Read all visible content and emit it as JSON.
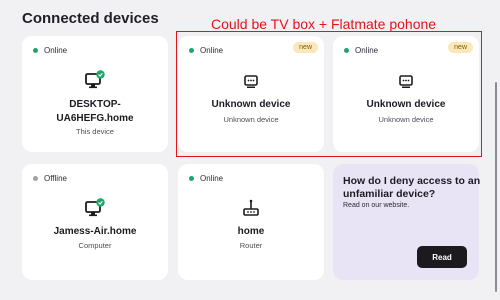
{
  "page": {
    "title": "Connected devices"
  },
  "annotation": {
    "text": "Could be TV box + Flatmate pohone",
    "color": "#e0151b"
  },
  "colors": {
    "online": "#21a36b",
    "offline": "#a0a0a8",
    "badge_bg": "#fbe7b8",
    "info_bg": "#e9e4f5"
  },
  "devices": [
    {
      "status": "Online",
      "name_line1": "DESKTOP-",
      "name_line2": "UA6HEFG.home",
      "type": "This device",
      "icon": "computer-check-icon"
    },
    {
      "status": "Online",
      "badge": "new",
      "name_line1": "Unknown device",
      "type": "Unknown device",
      "icon": "unknown-device-icon"
    },
    {
      "status": "Online",
      "badge": "new",
      "name_line1": "Unknown device",
      "type": "Unknown device",
      "icon": "unknown-device-icon"
    },
    {
      "status": "Offline",
      "name_line1": "Jamess-Air.home",
      "type": "Computer",
      "icon": "computer-check-icon"
    },
    {
      "status": "Online",
      "name_line1": "home",
      "type": "Router",
      "icon": "router-icon"
    }
  ],
  "info": {
    "title": "How do I deny access to an unfamiliar device?",
    "subtitle": "Read on our website.",
    "button": "Read"
  }
}
